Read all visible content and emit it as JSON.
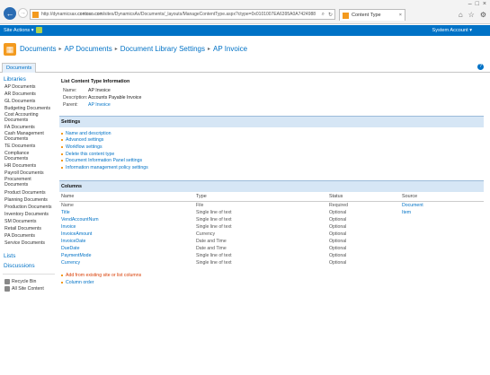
{
  "browser": {
    "url_prefix": "http://dynamicsax.",
    "url_domain": "contoso.com",
    "url_rest": "/sites/DynamicsAx/Documents/_layouts/ManageContentType.aspx?ctype=0x0101007EA6395A0A7424988",
    "tab_title": "Content Type",
    "search_glyph": "⌕",
    "refresh_glyph": "↻",
    "back_glyph": "←",
    "forward_glyph": "→",
    "close_glyph": "×",
    "min_glyph": "–",
    "max_glyph": "□",
    "home_glyph": "⌂",
    "star_glyph": "☆",
    "gear_glyph": "⚙"
  },
  "suite": {
    "site_actions": "Site Actions ▾",
    "account": "System Account ▾"
  },
  "breadcrumb": [
    "Documents",
    "AP Documents",
    "Document Library Settings",
    "AP Invoice"
  ],
  "breadcrumb_sep": "▸",
  "ribbon": {
    "documents_tab": "Documents",
    "help": "?"
  },
  "nav": {
    "libraries_heading": "Libraries",
    "libraries": [
      "AP Documents",
      "AR Documents",
      "GL Documents",
      "Budgeting Documents",
      "Cost Accounting Documents",
      "FA Documents",
      "Cash Management Documents",
      "TE Documents",
      "Compliance Documents",
      "HR Documents",
      "Payroll Documents",
      "Procurement Documents",
      "Product Documents",
      "Planning Documents",
      "Production Documents",
      "Inventory Documents",
      "SM Documents",
      "Retail Documents",
      "PA Documents",
      "Service Documents"
    ],
    "lists_heading": "Lists",
    "discussions_heading": "Discussions",
    "recycle_bin": "Recycle Bin",
    "all_site_content": "All Site Content"
  },
  "info": {
    "heading": "List Content Type Information",
    "name_label": "Name:",
    "name_value": "AP Invoice",
    "description_label": "Description:",
    "description_value": "Accounts Payable Invoice",
    "parent_label": "Parent:",
    "parent_value": "AP Invoice"
  },
  "settings": {
    "heading": "Settings",
    "links": [
      "Name and description",
      "Advanced settings",
      "Workflow settings",
      "Delete this content type",
      "Document Information Panel settings",
      "Information management policy settings"
    ]
  },
  "columns": {
    "heading": "Columns",
    "headers": [
      "Name",
      "Type",
      "Status",
      "Source"
    ],
    "rows": [
      {
        "name": "Name",
        "type": "File",
        "status": "Required",
        "source": "Document"
      },
      {
        "name": "Title",
        "type": "Single line of text",
        "status": "Optional",
        "source": "Item"
      },
      {
        "name": "VendAccountNum",
        "type": "Single line of text",
        "status": "Optional",
        "source": ""
      },
      {
        "name": "Invoice",
        "type": "Single line of text",
        "status": "Optional",
        "source": ""
      },
      {
        "name": "InvoiceAmount",
        "type": "Currency",
        "status": "Optional",
        "source": ""
      },
      {
        "name": "InvoiceDate",
        "type": "Date and Time",
        "status": "Optional",
        "source": ""
      },
      {
        "name": "DueDate",
        "type": "Date and Time",
        "status": "Optional",
        "source": ""
      },
      {
        "name": "PaymentMode",
        "type": "Single line of text",
        "status": "Optional",
        "source": ""
      },
      {
        "name": "Currency",
        "type": "Single line of text",
        "status": "Optional",
        "source": ""
      }
    ],
    "add_link": "Add from existing site or list columns",
    "order_link": "Column order"
  },
  "colors": {
    "suite_bar": "#0072c6",
    "accent_orange": "#f39a1e",
    "link_blue": "#0072c6",
    "section_bar": "#d6e6f5"
  }
}
